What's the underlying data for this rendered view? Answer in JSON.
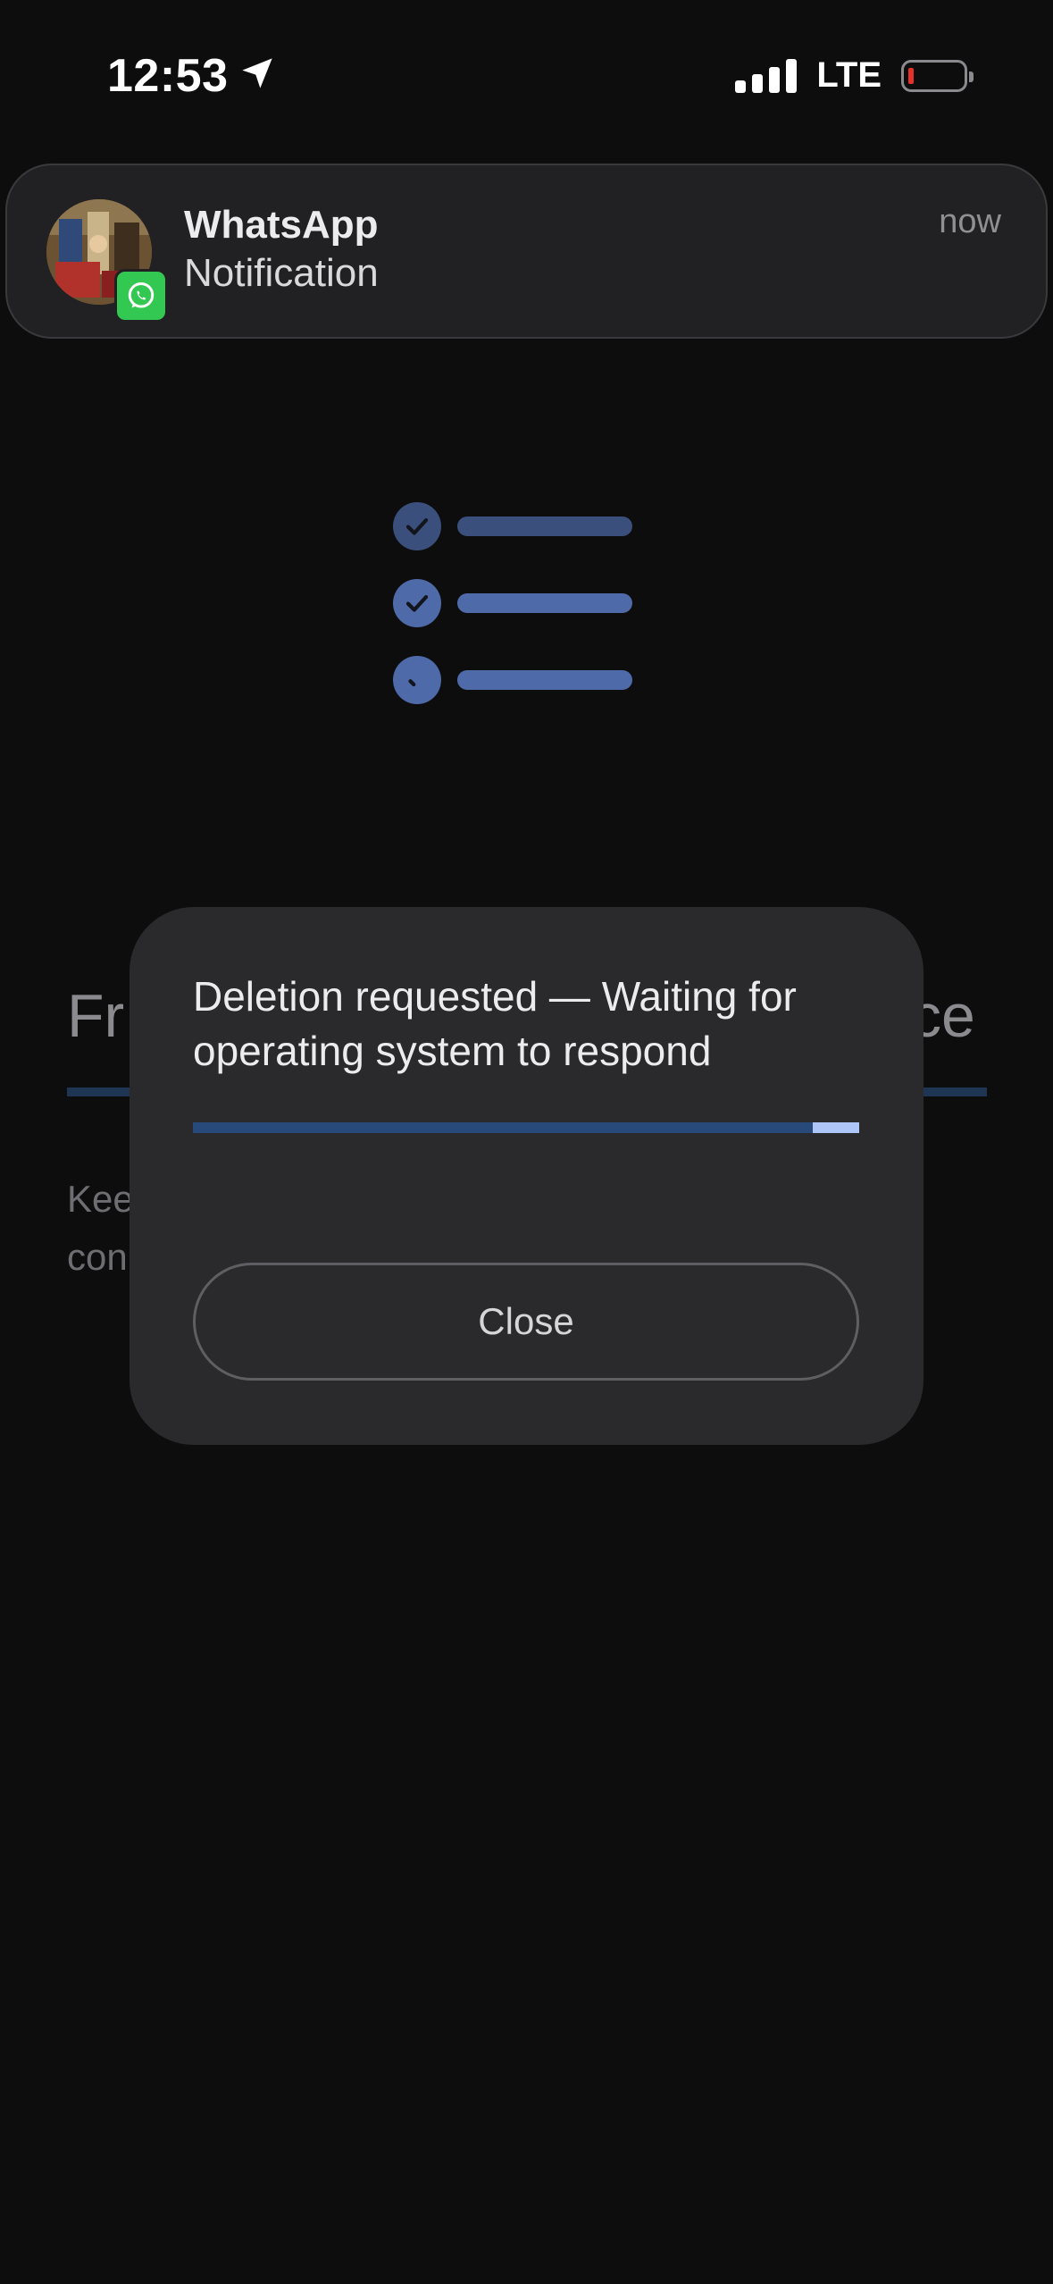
{
  "status_bar": {
    "time": "12:53",
    "network": "LTE",
    "battery_level": 0.05
  },
  "notification": {
    "app": "WhatsApp",
    "body": "Notification",
    "time": "now"
  },
  "illustration": {
    "rows": [
      "checked",
      "checked",
      "pending"
    ],
    "colors": {
      "dim": "#3b4f7c",
      "bright": "#4f6aa8"
    }
  },
  "background_page": {
    "heading_left": "Fr",
    "heading_right": "ce",
    "text_line1": "Kee",
    "text_line2": "con"
  },
  "dialog": {
    "title": "Deletion requested — Waiting for operating system to respond",
    "progress_fraction": 0.93,
    "close_label": "Close"
  },
  "colors": {
    "background": "#0d0d0e",
    "dialog": "#2a2a2c",
    "accent": "#aec6f7",
    "track": "#274a7a"
  }
}
